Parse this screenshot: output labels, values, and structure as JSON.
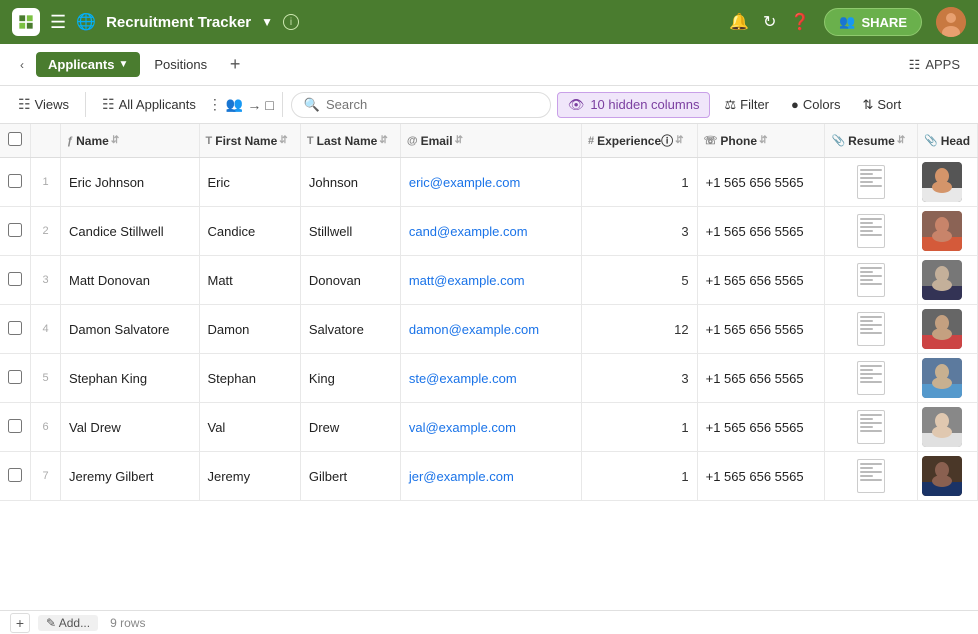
{
  "topNav": {
    "appTitle": "Recruitment Tracker",
    "shareLabel": "SHARE",
    "appsLabel": "APPS"
  },
  "tabs": {
    "active": "Applicants",
    "inactive": "Positions"
  },
  "toolbar": {
    "views": "Views",
    "allApplicants": "All Applicants",
    "searchPlaceholder": "Search",
    "hiddenColumns": "10 hidden columns",
    "filter": "Filter",
    "colors": "Colors",
    "sort": "Sort"
  },
  "table": {
    "columns": [
      "Name",
      "First Name",
      "Last Name",
      "Email",
      "Experience",
      "Phone",
      "Resume",
      "Head"
    ],
    "rows": [
      {
        "num": 1,
        "name": "Eric Johnson",
        "firstName": "Eric",
        "lastName": "Johnson",
        "email": "eric@example.com",
        "experience": 1,
        "phone": "+1 565 656 5565",
        "avatarColor": "#555"
      },
      {
        "num": 2,
        "name": "Candice Stillwell",
        "firstName": "Candice",
        "lastName": "Stillwell",
        "email": "cand@example.com",
        "experience": 3,
        "phone": "+1 565 656 5565",
        "avatarColor": "#b5651d"
      },
      {
        "num": 3,
        "name": "Matt Donovan",
        "firstName": "Matt",
        "lastName": "Donovan",
        "email": "matt@example.com",
        "experience": 5,
        "phone": "+1 565 656 5565",
        "avatarColor": "#777"
      },
      {
        "num": 4,
        "name": "Damon Salvatore",
        "firstName": "Damon",
        "lastName": "Salvatore",
        "email": "damon@example.com",
        "experience": 12,
        "phone": "+1 565 656 5565",
        "avatarColor": "#666"
      },
      {
        "num": 5,
        "name": "Stephan King",
        "firstName": "Stephan",
        "lastName": "King",
        "email": "ste@example.com",
        "experience": 3,
        "phone": "+1 565 656 5565",
        "avatarColor": "#5c7a9e"
      },
      {
        "num": 6,
        "name": "Val Drew",
        "firstName": "Val",
        "lastName": "Drew",
        "email": "val@example.com",
        "experience": 1,
        "phone": "+1 565 656 5565",
        "avatarColor": "#888"
      },
      {
        "num": 7,
        "name": "Jeremy Gilbert",
        "firstName": "Jeremy",
        "lastName": "Gilbert",
        "email": "jer@example.com",
        "experience": 1,
        "phone": "+1 565 656 5565",
        "avatarColor": "#4a3728"
      }
    ],
    "rowCount": "9 rows"
  },
  "bottomBar": {
    "addLabel": "Add...",
    "rowCount": "9 rows"
  }
}
